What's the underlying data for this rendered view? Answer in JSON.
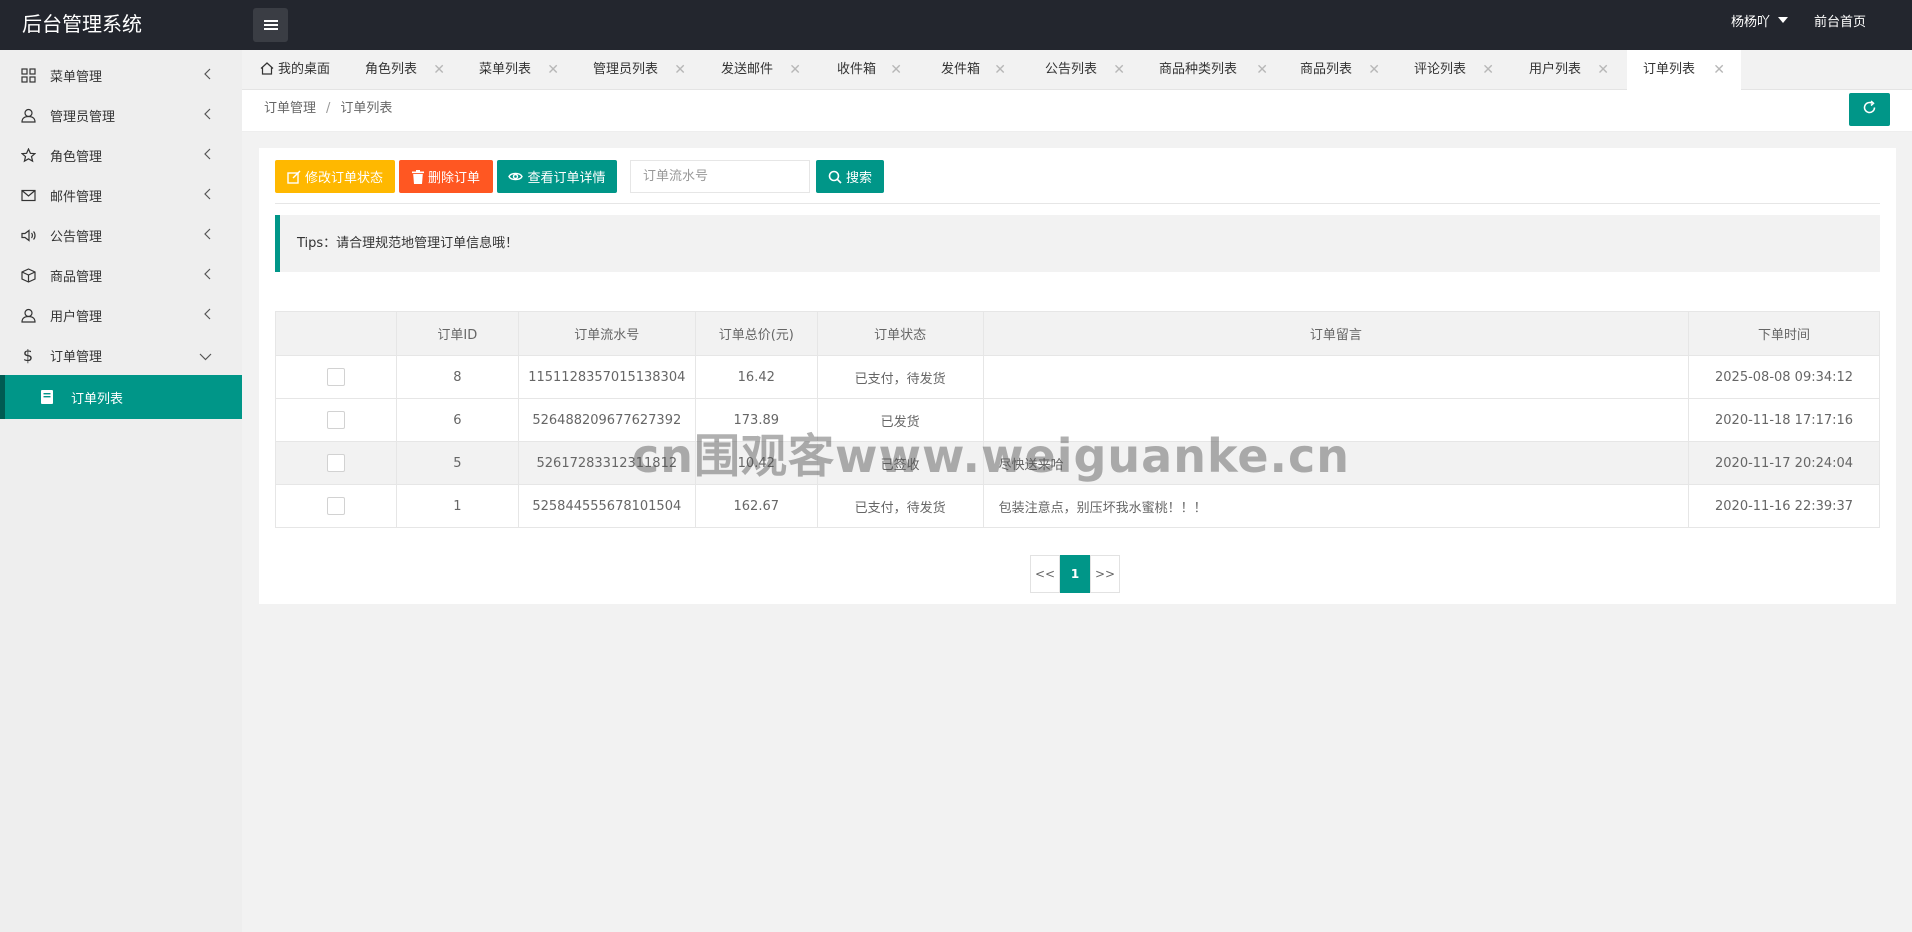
{
  "app": {
    "title": "后台管理系统"
  },
  "header": {
    "user_name": "杨杨吖",
    "front_link": "前台首页"
  },
  "sidebar": {
    "items": [
      {
        "label": "菜单管理",
        "icon": "grid-icon"
      },
      {
        "label": "管理员管理",
        "icon": "user-icon"
      },
      {
        "label": "角色管理",
        "icon": "star-icon"
      },
      {
        "label": "邮件管理",
        "icon": "mail-icon"
      },
      {
        "label": "公告管理",
        "icon": "speaker-icon"
      },
      {
        "label": "商品管理",
        "icon": "cube-icon"
      },
      {
        "label": "用户管理",
        "icon": "user-icon"
      },
      {
        "label": "订单管理",
        "icon": "dollar-icon"
      }
    ],
    "sub_item": "订单列表"
  },
  "tabs": [
    "我的桌面",
    "角色列表",
    "菜单列表",
    "管理员列表",
    "发送邮件",
    "收件箱",
    "发件箱",
    "公告列表",
    "商品种类列表",
    "商品列表",
    "评论列表",
    "用户列表",
    "订单列表"
  ],
  "breadcrumb": {
    "parent": "订单管理",
    "sep": "/",
    "current": "订单列表"
  },
  "toolbar": {
    "edit_status": "修改订单状态",
    "delete": "删除订单",
    "view_detail": "查看订单详情",
    "search_placeholder": "订单流水号",
    "search": "搜索"
  },
  "tips": "Tips：请合理规范地管理订单信息哦！",
  "table": {
    "headers": [
      "订单ID",
      "订单流水号",
      "订单总价(元)",
      "订单状态",
      "订单留言",
      "下单时间"
    ],
    "rows": [
      {
        "id": "8",
        "serial": "1151128357015138304",
        "price": "16.42",
        "status": "已支付，待发货",
        "note": "",
        "time": "2025-08-08 09:34:12"
      },
      {
        "id": "6",
        "serial": "526488209677627392",
        "price": "173.89",
        "status": "已发货",
        "note": "",
        "time": "2020-11-18 17:17:16"
      },
      {
        "id": "5",
        "serial": "52617283312311812",
        "price": "10.42",
        "status": "已签收",
        "note": "尽快送来哈",
        "time": "2020-11-17 20:24:04"
      },
      {
        "id": "1",
        "serial": "525844555678101504",
        "price": "162.67",
        "status": "已支付，待发货",
        "note": "包装注意点，别压坏我水蜜桃！！！",
        "time": "2020-11-16 22:39:37"
      }
    ]
  },
  "pager": {
    "prev": "<<",
    "current": "1",
    "next": ">>"
  },
  "watermark": "cn围观客www.weiguanke.cn",
  "colors": {
    "primary": "#009688",
    "warn": "#ffb800",
    "danger": "#ff5722",
    "topbar": "#23262e"
  }
}
